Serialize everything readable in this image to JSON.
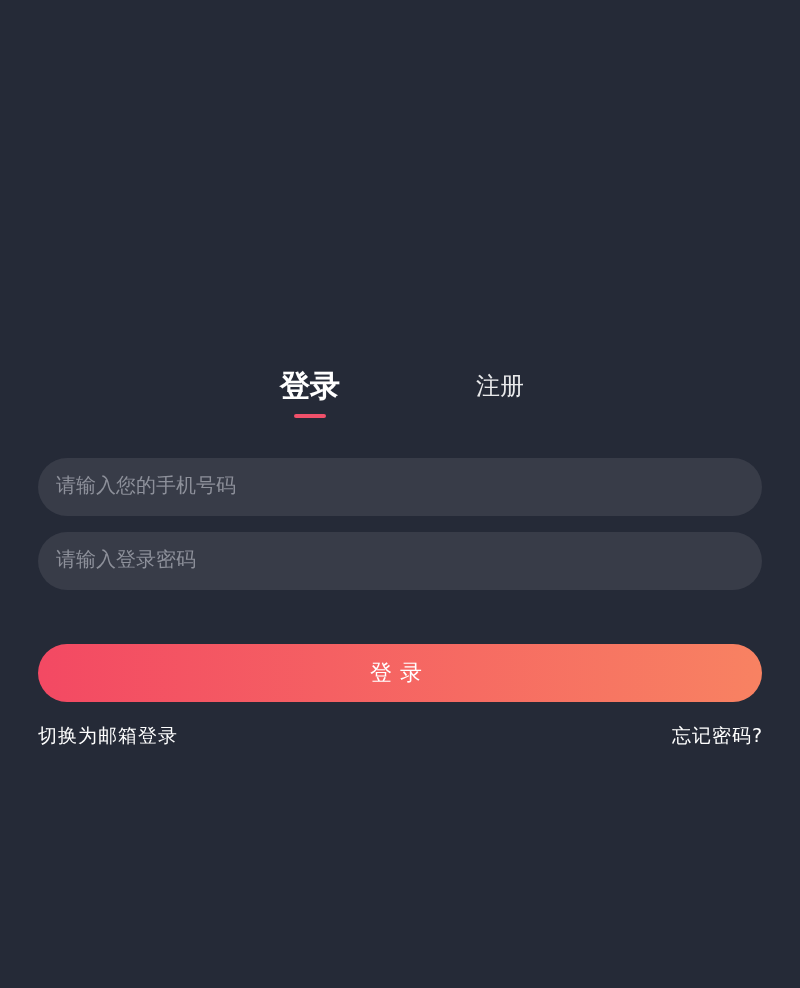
{
  "tabs": [
    {
      "label": "登录",
      "selected": true
    },
    {
      "label": "注册",
      "selected": false
    }
  ],
  "fields": [
    {
      "placeholder": "请输入您的手机号码"
    },
    {
      "placeholder": "请输入登录密码"
    }
  ],
  "submit_button": "登录",
  "links": {
    "switch": "切换为邮箱登录",
    "forgot": "忘记密码?"
  }
}
